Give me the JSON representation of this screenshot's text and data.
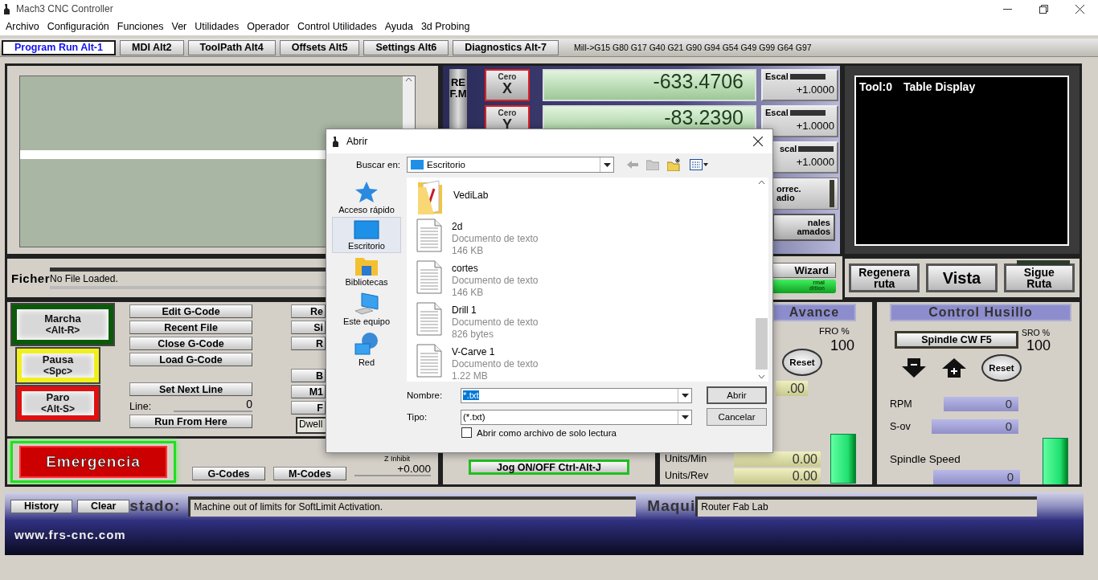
{
  "window": {
    "title": "Mach3 CNC Controller"
  },
  "menu": [
    "Archivo",
    "Configuración",
    "Funciones",
    "Ver",
    "Utilidades",
    "Operador",
    "Control Utilidades",
    "Ayuda",
    "3d Probing"
  ],
  "tabs": [
    {
      "label": "Program Run Alt-1",
      "selected": true
    },
    {
      "label": "MDI Alt2",
      "selected": false
    },
    {
      "label": "ToolPath Alt4",
      "selected": false
    },
    {
      "label": "Offsets Alt5",
      "selected": false
    },
    {
      "label": "Settings Alt6",
      "selected": false
    },
    {
      "label": "Diagnostics Alt-7",
      "selected": false
    }
  ],
  "modal_line": "Mill->G15  G80 G17 G40 G21 G90 G94 G54 G49 G99 G64 G97",
  "dro": {
    "ref_label": "REF.M",
    "axes": [
      {
        "zero_label": "Cero",
        "axis": "X",
        "value": "-633.4706",
        "scale_label": "Escal",
        "scale": "+1.0000"
      },
      {
        "zero_label": "Cero",
        "axis": "Y",
        "value": "-83.2390",
        "scale_label": "Escal",
        "scale": "+1.0000"
      },
      {
        "scale_label": "scal",
        "scale": "+1.0000"
      }
    ],
    "radius_label": "orrec.\nadio",
    "offsets_button": "nales\namados"
  },
  "toolpath": {
    "tool": "Tool:0",
    "title": "Table Display",
    "buttons": [
      "Regenera\nruta",
      "Vista",
      "Sigue\nRuta"
    ]
  },
  "file": {
    "label": "Ficher",
    "value": "No File Loaded."
  },
  "wizard": {
    "button": "Wizard",
    "edition": "rmal\ndition"
  },
  "run_controls": [
    {
      "kind": "start",
      "label": "Marcha",
      "shortcut": "<Alt-R>",
      "color": "#0a5a0a"
    },
    {
      "kind": "pause",
      "label": "Pausa",
      "shortcut": "<Spc>",
      "color": "#f0f020"
    },
    {
      "kind": "stop",
      "label": "Paro",
      "shortcut": "<Alt-S>",
      "color": "#e01010"
    }
  ],
  "program_buttons": [
    "Edit G-Code",
    "Recent File",
    "Close G-Code",
    "Load G-Code"
  ],
  "set_next_line": "Set Next Line",
  "line": {
    "label": "Line:",
    "value": "0"
  },
  "run_from_here": "Run From Here",
  "covered_buttons": [
    {
      "kind": "button",
      "label": "Re"
    },
    {
      "kind": "button",
      "label": "Si"
    },
    {
      "kind": "button",
      "label": "R"
    },
    {
      "kind": "gap"
    },
    {
      "kind": "button",
      "label": "B"
    },
    {
      "kind": "button",
      "label": "M1"
    },
    {
      "kind": "button",
      "label": "F"
    },
    {
      "kind": "field",
      "label": "Dwell"
    }
  ],
  "emergency": "Emergencia",
  "code_buttons": [
    "G-Codes",
    "M-Codes"
  ],
  "z_inhibit": {
    "label": "Z Inhibit",
    "value": "+0.000"
  },
  "jog": {
    "toggle": "Jog ON/OFF Ctrl-Alt-J"
  },
  "feed": {
    "title": "Avance",
    "fro_label": "FRO %",
    "fro": "100",
    "reset": "Reset",
    "feed_value": ".00",
    "rows": [
      {
        "label": "Units/Min",
        "value": "0.00"
      },
      {
        "label": "Units/Rev",
        "value": "0.00"
      }
    ]
  },
  "spindle": {
    "title": "Control Husillo",
    "toggle": "Spindle CW F5",
    "sro_label": "SRO %",
    "sro": "100",
    "reset": "Reset",
    "rows": [
      {
        "label": "RPM",
        "value": "0"
      },
      {
        "label": "S-ov",
        "value": "0"
      }
    ],
    "speed_label": "Spindle Speed",
    "speed": "0"
  },
  "status": {
    "history": "History",
    "clear": "Clear",
    "label": "stado:",
    "message": "Machine out of limits for SoftLimit Activation.",
    "profile_label": "Maqui",
    "profile": "Router Fab Lab",
    "url": "www.frs-cnc.com"
  },
  "dialog": {
    "title": "Abrir",
    "look_in_label": "Buscar en:",
    "look_in": "Escritorio",
    "places": [
      {
        "kind": "quick",
        "label": "Acceso rápido",
        "selected": false
      },
      {
        "kind": "desktop",
        "label": "Escritorio",
        "selected": true
      },
      {
        "kind": "libraries",
        "label": "Bibliotecas",
        "selected": false
      },
      {
        "kind": "computer",
        "label": "Este equipo",
        "selected": false
      },
      {
        "kind": "network",
        "label": "Red",
        "selected": false
      }
    ],
    "files": [
      {
        "kind": "folder",
        "name": "VediLab"
      },
      {
        "kind": "document",
        "name": "2d",
        "type": "Documento de texto",
        "size": "146 KB"
      },
      {
        "kind": "document",
        "name": "cortes",
        "type": "Documento de texto",
        "size": "146 KB"
      },
      {
        "kind": "document",
        "name": "Drill 1",
        "type": "Documento de texto",
        "size": "826 bytes"
      },
      {
        "kind": "document",
        "name": "V-Carve 1",
        "type": "Documento de texto",
        "size": "1.22 MB"
      }
    ],
    "name_label": "Nombre:",
    "name_value": "*.txt",
    "type_label": "Tipo:",
    "type_value": "(*.txt)",
    "open_button": "Abrir",
    "cancel_button": "Cancelar",
    "readonly": {
      "label": "Abrir como archivo de solo lectura",
      "checked": false
    }
  }
}
